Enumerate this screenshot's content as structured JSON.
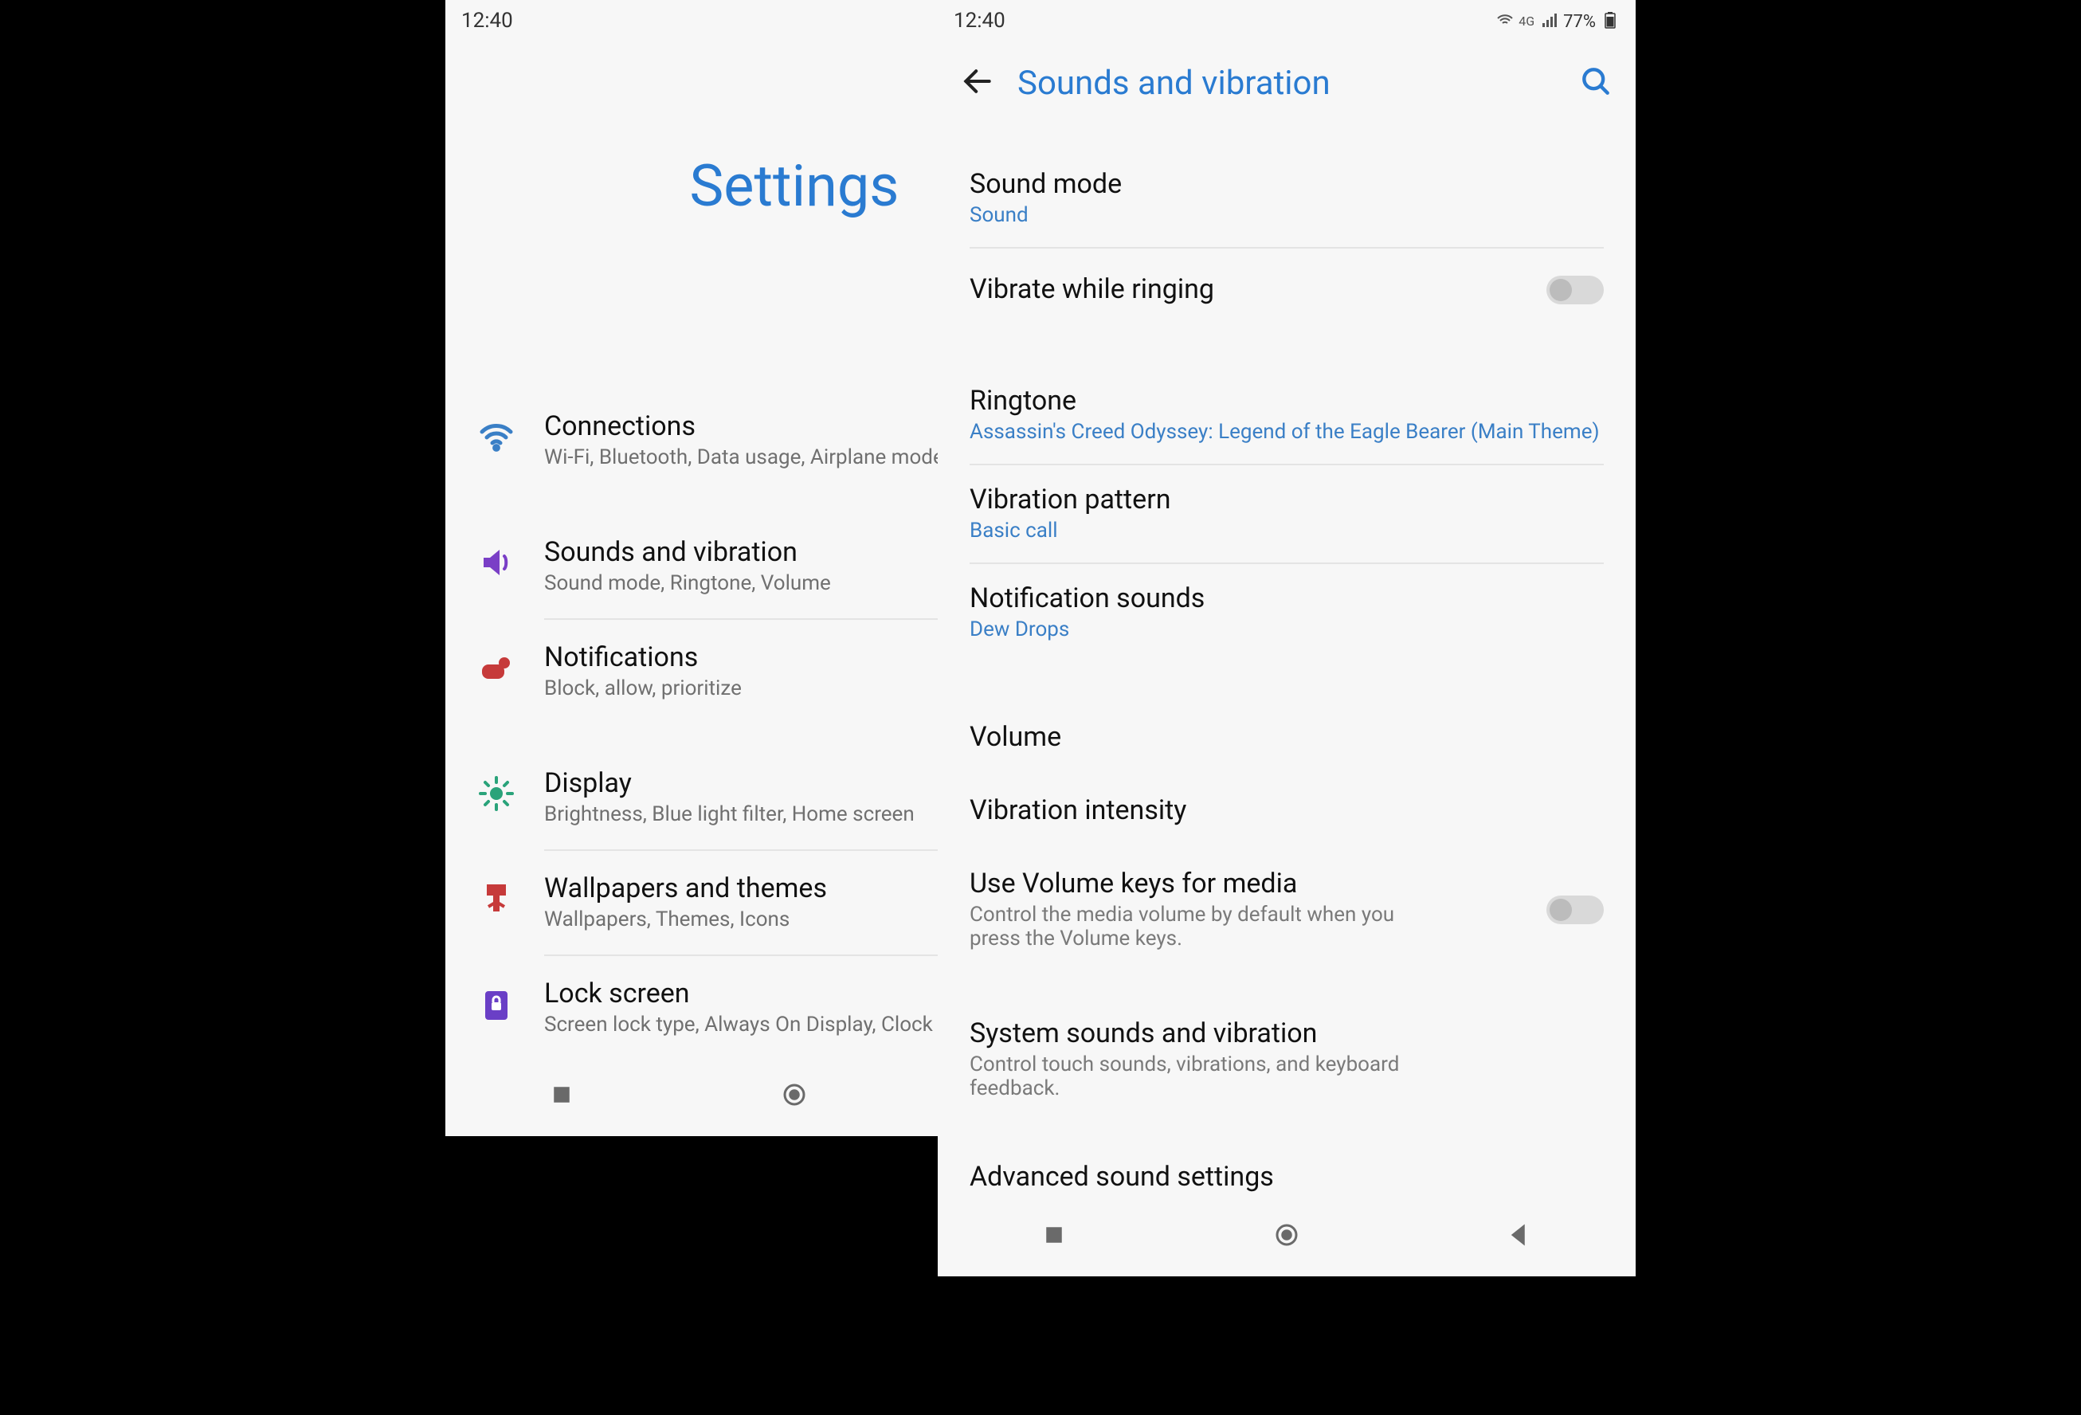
{
  "status": {
    "time": "12:40",
    "network_label": "4G",
    "battery_text": "77%"
  },
  "screen1": {
    "title": "Settings",
    "items": [
      {
        "icon": "wifi-icon",
        "title": "Connections",
        "sub": "Wi-Fi, Bluetooth, Data usage, Airplane mode"
      },
      {
        "icon": "sound-icon",
        "title": "Sounds and vibration",
        "sub": "Sound mode, Ringtone, Volume"
      },
      {
        "icon": "notifications-icon",
        "title": "Notifications",
        "sub": "Block, allow, prioritize"
      },
      {
        "icon": "display-icon",
        "title": "Display",
        "sub": "Brightness, Blue light filter, Home screen"
      },
      {
        "icon": "wallpaper-icon",
        "title": "Wallpapers and themes",
        "sub": "Wallpapers, Themes, Icons"
      },
      {
        "icon": "lock-icon",
        "title": "Lock screen",
        "sub": "Screen lock type, Always On Display, Clock style"
      }
    ]
  },
  "screen2": {
    "title": "Sounds and vibration",
    "prefs": {
      "sound_mode": {
        "title": "Sound mode",
        "value": "Sound"
      },
      "vibrate_ringing": {
        "title": "Vibrate while ringing",
        "toggled": false
      },
      "ringtone": {
        "title": "Ringtone",
        "value": "Assassin's Creed Odyssey: Legend of the Eagle Bearer (Main Theme)"
      },
      "vibration_pattern": {
        "title": "Vibration pattern",
        "value": "Basic call"
      },
      "notification_sounds": {
        "title": "Notification sounds",
        "value": "Dew Drops"
      },
      "volume": {
        "title": "Volume"
      },
      "vibration_intensity": {
        "title": "Vibration intensity"
      },
      "volume_keys_media": {
        "title": "Use Volume keys for media",
        "desc": "Control the media volume by default when you press the Volume keys.",
        "toggled": false
      },
      "system_sounds": {
        "title": "System sounds and vibration",
        "desc": "Control touch sounds, vibrations, and keyboard feedback."
      },
      "advanced": {
        "title": "Advanced sound settings"
      }
    }
  },
  "colors": {
    "accent": "#2a7bd1",
    "icon_connections": "#3a7fc6",
    "icon_sounds": "#7a3fc6",
    "icon_notifications": "#c63a3a",
    "icon_display": "#2aa37a",
    "icon_wallpaper": "#c63a3a",
    "icon_lock": "#6a3fc6"
  }
}
